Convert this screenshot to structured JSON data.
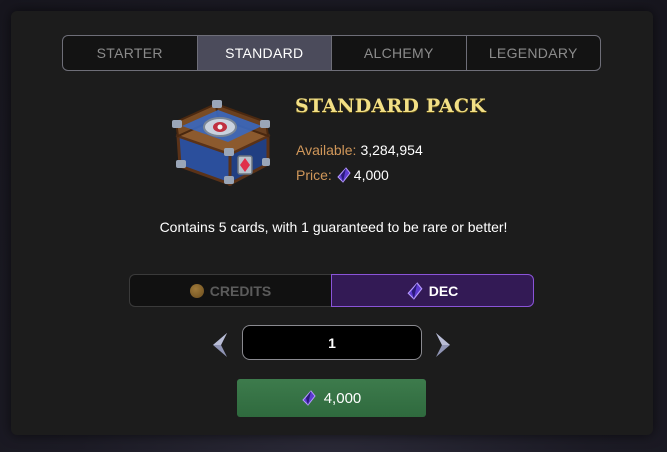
{
  "tabs": [
    {
      "label": "STARTER",
      "active": false
    },
    {
      "label": "STANDARD",
      "active": true
    },
    {
      "label": "ALCHEMY",
      "active": false
    },
    {
      "label": "LEGENDARY",
      "active": false
    }
  ],
  "pack": {
    "title": "STANDARD PACK",
    "available_label": "Available:",
    "available_value": "3,284,954",
    "price_label": "Price:",
    "price_value": "4,000",
    "description": "Contains 5 cards, with 1 guaranteed to be rare or better!",
    "image_icon": "chest-icon"
  },
  "currency": {
    "credits_label": "CREDITS",
    "dec_label": "DEC",
    "selected": "DEC"
  },
  "quantity": {
    "value": "1"
  },
  "buy_button": {
    "label": "4,000",
    "icon": "dec-gem-icon"
  },
  "colors": {
    "title_gold": "#f2df85",
    "label_orange": "#d0975a",
    "dec_purple": "#331a55",
    "dec_border": "#8a54d8",
    "buy_green": "#3d7b4c",
    "active_tab": "#4b4b5b"
  }
}
